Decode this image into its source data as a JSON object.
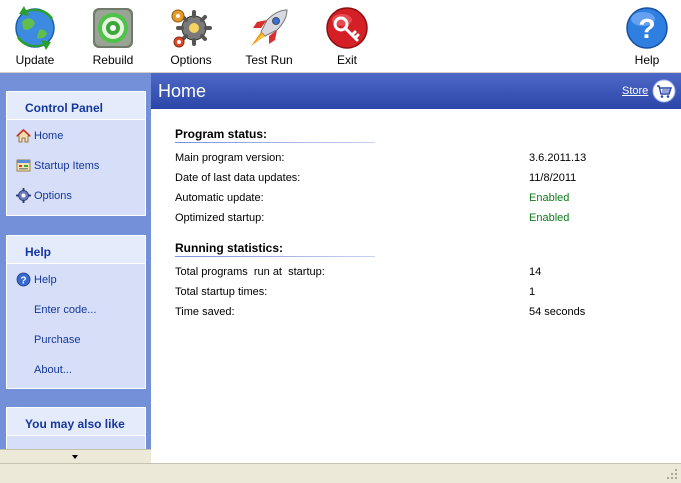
{
  "toolbar": {
    "buttons": [
      {
        "label": "Update",
        "icon": "update-globe-icon"
      },
      {
        "label": "Rebuild",
        "icon": "rebuild-disc-icon"
      },
      {
        "label": "Options",
        "icon": "options-gears-icon"
      },
      {
        "label": "Test Run",
        "icon": "rocket-icon"
      },
      {
        "label": "Exit",
        "icon": "exit-key-icon"
      },
      {
        "label": "Help",
        "icon": "help-question-icon"
      }
    ]
  },
  "sidebar": {
    "control_panel": {
      "title": "Control Panel",
      "items": [
        {
          "label": "Home",
          "icon": "home-icon"
        },
        {
          "label": "Startup Items",
          "icon": "startup-items-icon"
        },
        {
          "label": "Options",
          "icon": "gear-icon"
        }
      ]
    },
    "help": {
      "title": "Help",
      "items": [
        {
          "label": "Help",
          "icon": "help-icon"
        },
        {
          "label": "Enter code..."
        },
        {
          "label": "Purchase"
        },
        {
          "label": "About..."
        }
      ]
    },
    "also_like": {
      "title": "You may also like"
    }
  },
  "main": {
    "title": "Home",
    "store_label": "Store",
    "program_status": {
      "title": "Program status:",
      "rows": [
        {
          "label": "Main program version:",
          "value": "3.6.2011.13"
        },
        {
          "label": "Date of last data updates:",
          "value": "11/8/2011"
        },
        {
          "label": "Automatic update:",
          "value": "Enabled"
        },
        {
          "label": "Optimized startup:",
          "value": "Enabled"
        }
      ]
    },
    "running_statistics": {
      "title": "Running statistics:",
      "rows": [
        {
          "label": "Total programs  run at  startup:",
          "value": "14"
        },
        {
          "label": "Total startup times:",
          "value": "1"
        },
        {
          "label": "Time saved:",
          "value": "54 seconds"
        }
      ]
    }
  },
  "colors": {
    "header_blue": "#2b46a8",
    "sidebar_blue": "#7390d8",
    "panel_bg": "#d6dff7",
    "link_blue": "#15379c",
    "enabled_green": "#0f7a1c"
  }
}
